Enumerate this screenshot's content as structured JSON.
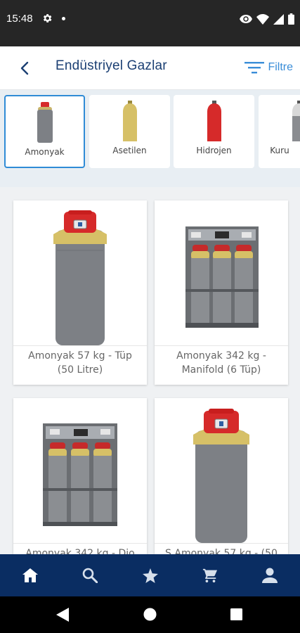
{
  "status_bar": {
    "time": "15:48",
    "icons": [
      "gear-icon",
      "notification-dot",
      "eye-icon",
      "wifi-icon",
      "signal-icon",
      "battery-icon"
    ]
  },
  "header": {
    "back_icon": "chevron-left-icon",
    "title": "Endüstriyel Gazlar",
    "filter_icon": "filter-lines-icon",
    "filter_label": "Filtre"
  },
  "categories": [
    {
      "label": "Amonyak",
      "selected": true,
      "icon": "gray-cylinder-red-cap"
    },
    {
      "label": "Asetilen",
      "selected": false,
      "icon": "yellow-cylinder"
    },
    {
      "label": "Hidrojen",
      "selected": false,
      "icon": "red-cylinder"
    },
    {
      "label": "Kuru",
      "selected": false,
      "icon": "gray-cylinder"
    }
  ],
  "products": [
    {
      "name": "Amonyak 57 kg - Tüp (50 Litre)",
      "image": "single-cylinder"
    },
    {
      "name": "Amonyak 342 kg - Manifold (6 Tüp)",
      "image": "manifold-rack"
    },
    {
      "name": "Amonyak 342 kg - Dio",
      "image": "manifold-rack"
    },
    {
      "name": "S Amonyak 57 kg - (50",
      "image": "single-cylinder"
    }
  ],
  "bottom_nav": [
    {
      "icon": "home-icon",
      "active": true
    },
    {
      "icon": "search-icon",
      "active": false
    },
    {
      "icon": "star-icon",
      "active": false
    },
    {
      "icon": "cart-icon",
      "active": false
    },
    {
      "icon": "user-icon",
      "active": false
    }
  ],
  "system_nav": [
    "back-triangle-icon",
    "home-circle-icon",
    "recents-square-icon"
  ],
  "colors": {
    "primary_navy": "#0a2d62",
    "title_blue": "#1b3f73",
    "accent_blue": "#3a8dd8",
    "selected_border": "#2f8bd6",
    "cylinder_gray": "#7d8085",
    "cylinder_yellow": "#d6c067",
    "cap_red": "#d62a2a"
  }
}
